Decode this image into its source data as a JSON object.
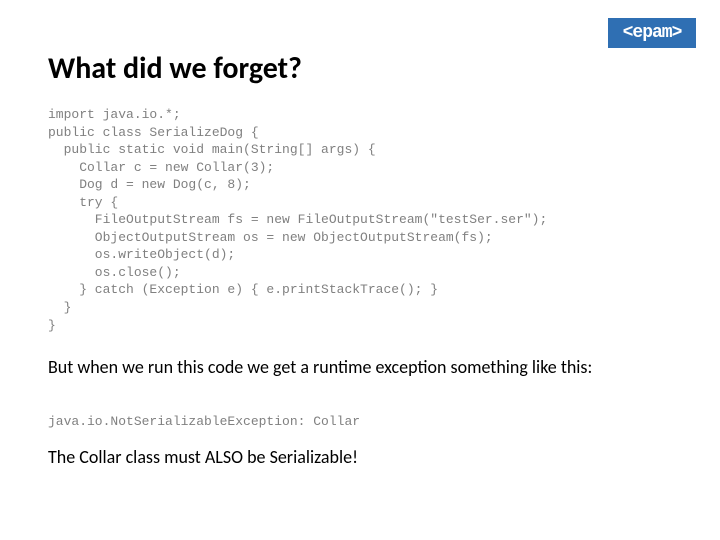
{
  "logo": {
    "text": "<epam>"
  },
  "title": "What did we forget?",
  "code": "import java.io.*;\npublic class SerializeDog {\n  public static void main(String[] args) {\n    Collar c = new Collar(3);\n    Dog d = new Dog(c, 8);\n    try {\n      FileOutputStream fs = new FileOutputStream(\"testSer.ser\");\n      ObjectOutputStream os = new ObjectOutputStream(fs);\n      os.writeObject(d);\n      os.close();\n    } catch (Exception e) { e.printStackTrace(); }\n  }\n}",
  "para1": "But when we run this code we get a runtime exception something like this:",
  "exception_line": "java.io.NotSerializableException: Collar",
  "para2": "The Collar class must ALSO be Serializable!"
}
